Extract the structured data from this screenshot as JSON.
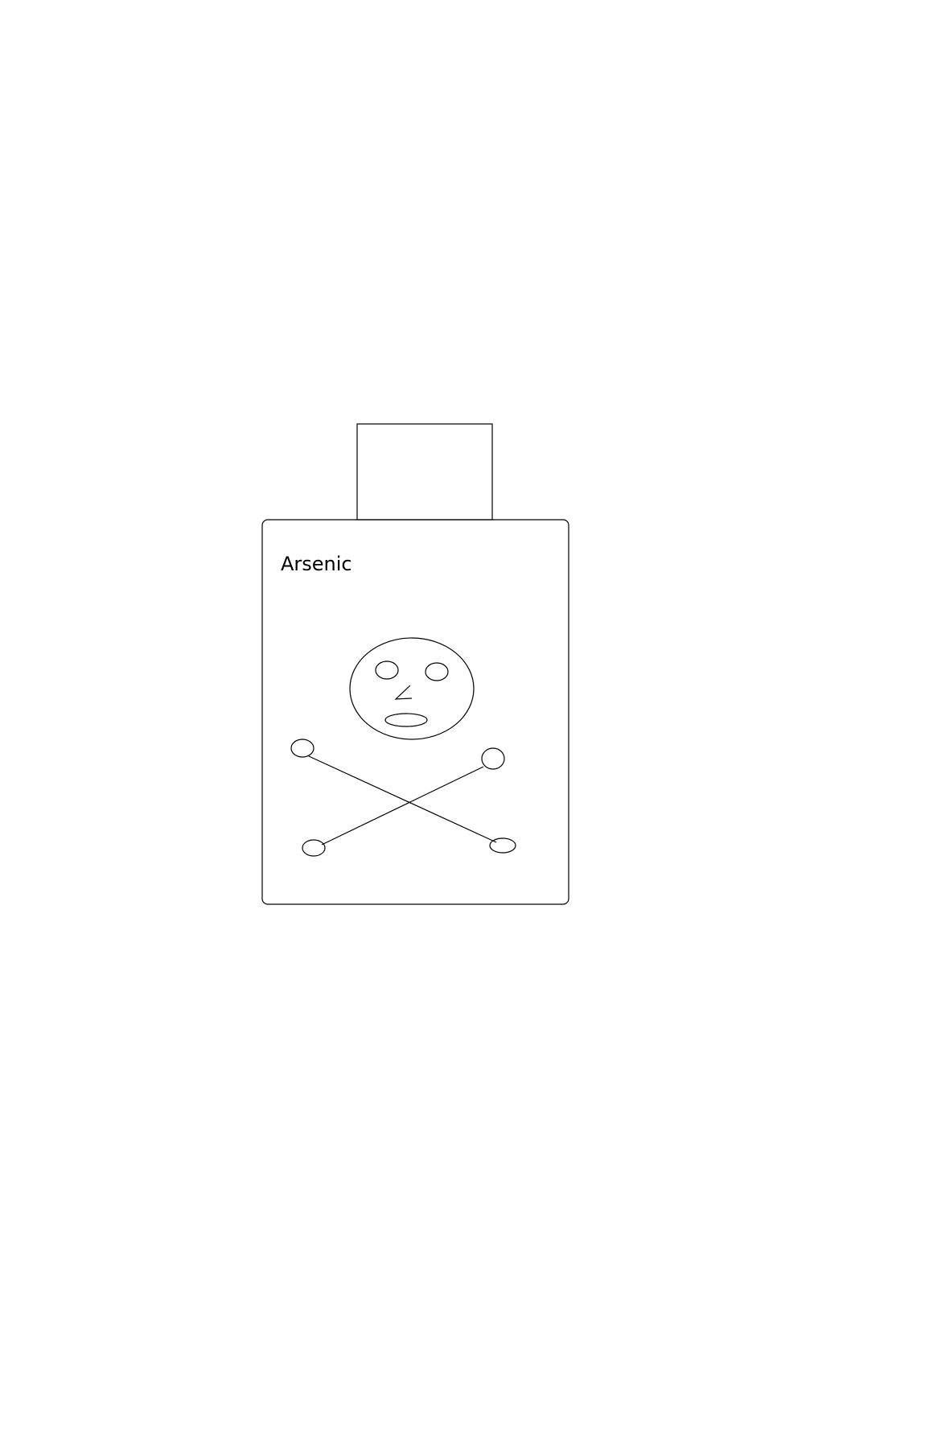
{
  "bottle": {
    "label": "Arsenic"
  },
  "colors": {
    "background": "#ffffff",
    "stroke": "#000000"
  },
  "icons": {
    "symbol": "skull-and-crossbones-icon"
  }
}
